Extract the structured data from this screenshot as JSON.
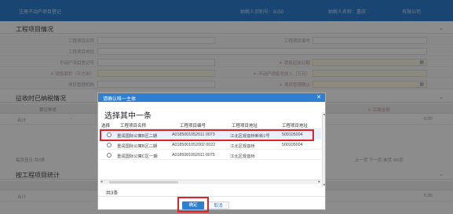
{
  "topbar": {
    "left_text": "注册不动产项目登记",
    "taxpayer_id_label": "纳税人识别号：9150",
    "taxpayer_name_label": "纳税人名称：重庆",
    "company_suffix": "有限公司"
  },
  "project_section": {
    "title": "工程项目情况",
    "fields": [
      {
        "label": "工程项目名称"
      },
      {
        "label": "工程项目地址"
      },
      {
        "label": "不动产项目登记号"
      },
      {
        "label": "＊ 销售面积（平方米）"
      },
      {
        "label": "项目管理机构"
      }
    ],
    "right_fields": [
      {
        "label": "工程项目编号"
      },
      {
        "label": "＊ 销售起始日期"
      },
      {
        "label": "＊ 不动产销售总收入（万元）"
      },
      {
        "label": "＊ 项目管理期止"
      }
    ]
  },
  "tax_section": {
    "title": "征收时已纳税情况",
    "head_left": "票证种类",
    "head_right": "＊ 实缴金额",
    "total_label": "合计",
    "total_dash": "-",
    "total_value": "0.00",
    "pager_left": "每页显示 共0条",
    "pager_right": "上一页  下一页  末页  0/0页"
  },
  "stats_section": {
    "title": "按工程项目统计",
    "total_label": "合计",
    "total_value": "0.00"
  },
  "modal": {
    "title": "请确认唯一主体",
    "close_glyph": "✕",
    "prompt": "选择其中一条",
    "columns": [
      "选择",
      "工程项目名称",
      "工程项目编号",
      "工程项目地址",
      "工程项目地址"
    ],
    "rows": [
      {
        "name": "重润国际公寓B区二期",
        "code": "A0185001052011 0073",
        "addr": "江北区观音桥新街1号",
        "addr2": "500105004"
      },
      {
        "name": "重润国际公寓B区二期",
        "code": "A0185001052002 0022",
        "addr": "江北区观音桥",
        "addr2": "500105004"
      },
      {
        "name": "重润国际公寓C区一期",
        "code": "A0185001052011 0075",
        "addr": "江北区观音桥",
        "addr2": ""
      }
    ],
    "count_text": "共3条",
    "confirm_label": "确定",
    "cancel_label": "取消"
  },
  "colors": {
    "brand_blue": "#2f7fd1",
    "highlight_red": "#e0232a"
  }
}
